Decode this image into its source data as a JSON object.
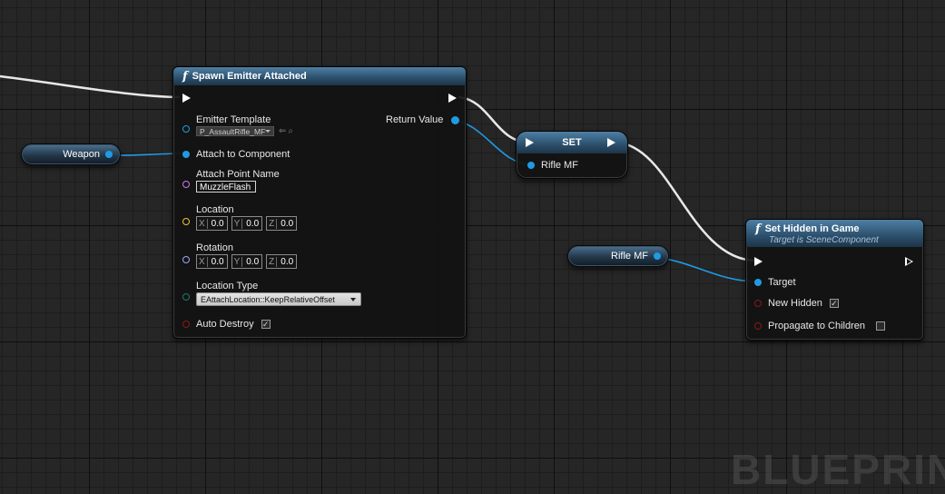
{
  "colors": {
    "exec_wire": "#e8e8e8",
    "object_wire": "#1f9be4",
    "name_pin": "#c57ce6",
    "vector_pin": "#f0c23e",
    "rotator_pin": "#9ca8ee",
    "enum_pin": "#1e7a65",
    "bool_pin": "#8b1818",
    "node_header": "#2b4f6c"
  },
  "watermark": "BLUEPRINT",
  "spawn_node": {
    "title": "Spawn Emitter Attached",
    "emitter_template_label": "Emitter Template",
    "emitter_template_value": "P_AssaultRifle_MF",
    "attach_to_component_label": "Attach to Component",
    "attach_point_name_label": "Attach Point Name",
    "attach_point_name_value": "MuzzleFlash",
    "location_label": "Location",
    "location": {
      "x": "0.0",
      "y": "0.0",
      "z": "0.0"
    },
    "rotation_label": "Rotation",
    "rotation": {
      "x": "0.0",
      "y": "0.0",
      "z": "0.0"
    },
    "axis_x": "X",
    "axis_y": "Y",
    "axis_z": "Z",
    "location_type_label": "Location Type",
    "location_type_value": "EAttachLocation::KeepRelativeOffset",
    "auto_destroy_label": "Auto Destroy",
    "auto_destroy_checked": "✓",
    "return_value_label": "Return Value"
  },
  "weapon_node": {
    "label": "Weapon"
  },
  "set_node": {
    "title": "SET",
    "rifle_mf_label": "Rifle MF"
  },
  "rifle_getter": {
    "label": "Rifle MF"
  },
  "set_hidden_node": {
    "title": "Set Hidden in Game",
    "subtitle": "Target is SceneComponent",
    "target_label": "Target",
    "new_hidden_label": "New Hidden",
    "new_hidden_checked": "✓",
    "propagate_label": "Propagate to Children",
    "propagate_checked": ""
  }
}
